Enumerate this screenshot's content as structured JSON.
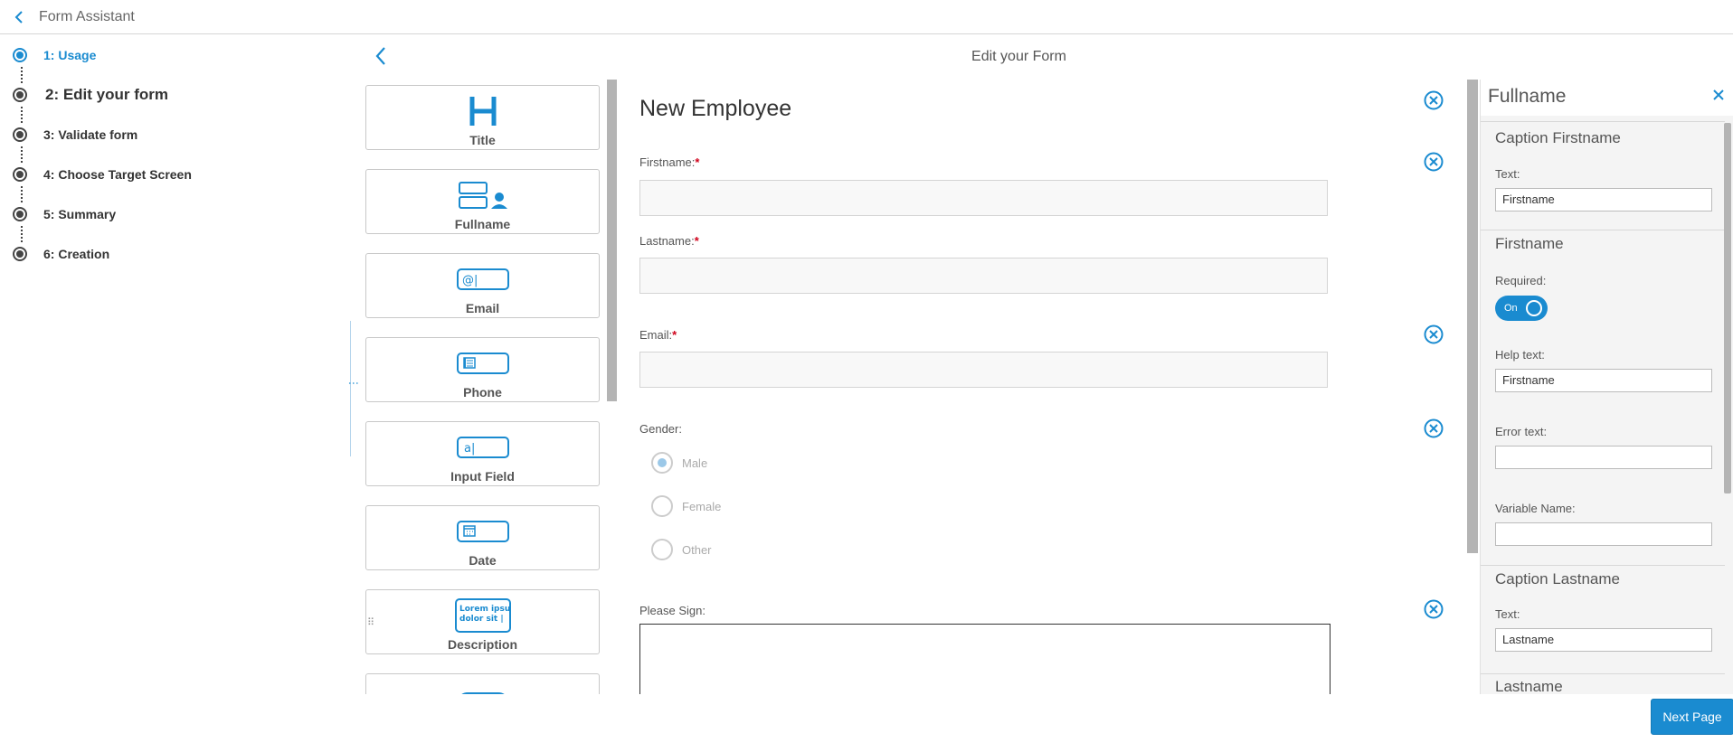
{
  "header": {
    "title": "Form Assistant"
  },
  "steps": [
    {
      "label": "1: Usage",
      "state": "active"
    },
    {
      "label": "2: Edit your form",
      "state": "current"
    },
    {
      "label": "3: Validate form",
      "state": "done"
    },
    {
      "label": "4: Choose Target Screen",
      "state": "done"
    },
    {
      "label": "5: Summary",
      "state": "done"
    },
    {
      "label": "6: Creation",
      "state": "done"
    }
  ],
  "editor": {
    "title": "Edit your Form"
  },
  "palette": [
    {
      "label": "Title",
      "icon": "heading-icon"
    },
    {
      "label": "Fullname",
      "icon": "fullname-icon"
    },
    {
      "label": "Email",
      "icon": "email-icon"
    },
    {
      "label": "Phone",
      "icon": "phone-icon"
    },
    {
      "label": "Input Field",
      "icon": "input-field-icon"
    },
    {
      "label": "Date",
      "icon": "date-icon"
    },
    {
      "label": "Description",
      "icon": "description-icon",
      "icon_text": [
        "Lorem ipsum",
        "dolor sit |"
      ]
    }
  ],
  "form": {
    "title": "New Employee",
    "firstname_label": "Firstname:",
    "lastname_label": "Lastname:",
    "email_label": "Email:",
    "required_mark": "*",
    "gender_label": "Gender:",
    "gender_options": [
      "Male",
      "Female",
      "Other"
    ],
    "gender_selected": "Male",
    "sign_label": "Please Sign:"
  },
  "props": {
    "title": "Fullname",
    "caption_firstname": {
      "title": "Caption Firstname",
      "text_label": "Text:",
      "text_value": "Firstname"
    },
    "firstname": {
      "title": "Firstname",
      "required_label": "Required:",
      "toggle_label": "On",
      "required": true,
      "help_label": "Help text:",
      "help_value": "Firstname",
      "error_label": "Error text:",
      "error_value": "",
      "variable_label": "Variable Name:",
      "variable_value": ""
    },
    "caption_lastname": {
      "title": "Caption Lastname",
      "text_label": "Text:",
      "text_value": "Lastname"
    },
    "lastname": {
      "title": "Lastname"
    }
  },
  "footer": {
    "next_label": "Next Page"
  },
  "colors": {
    "accent": "#1a8bd0",
    "required": "#d0021b"
  }
}
